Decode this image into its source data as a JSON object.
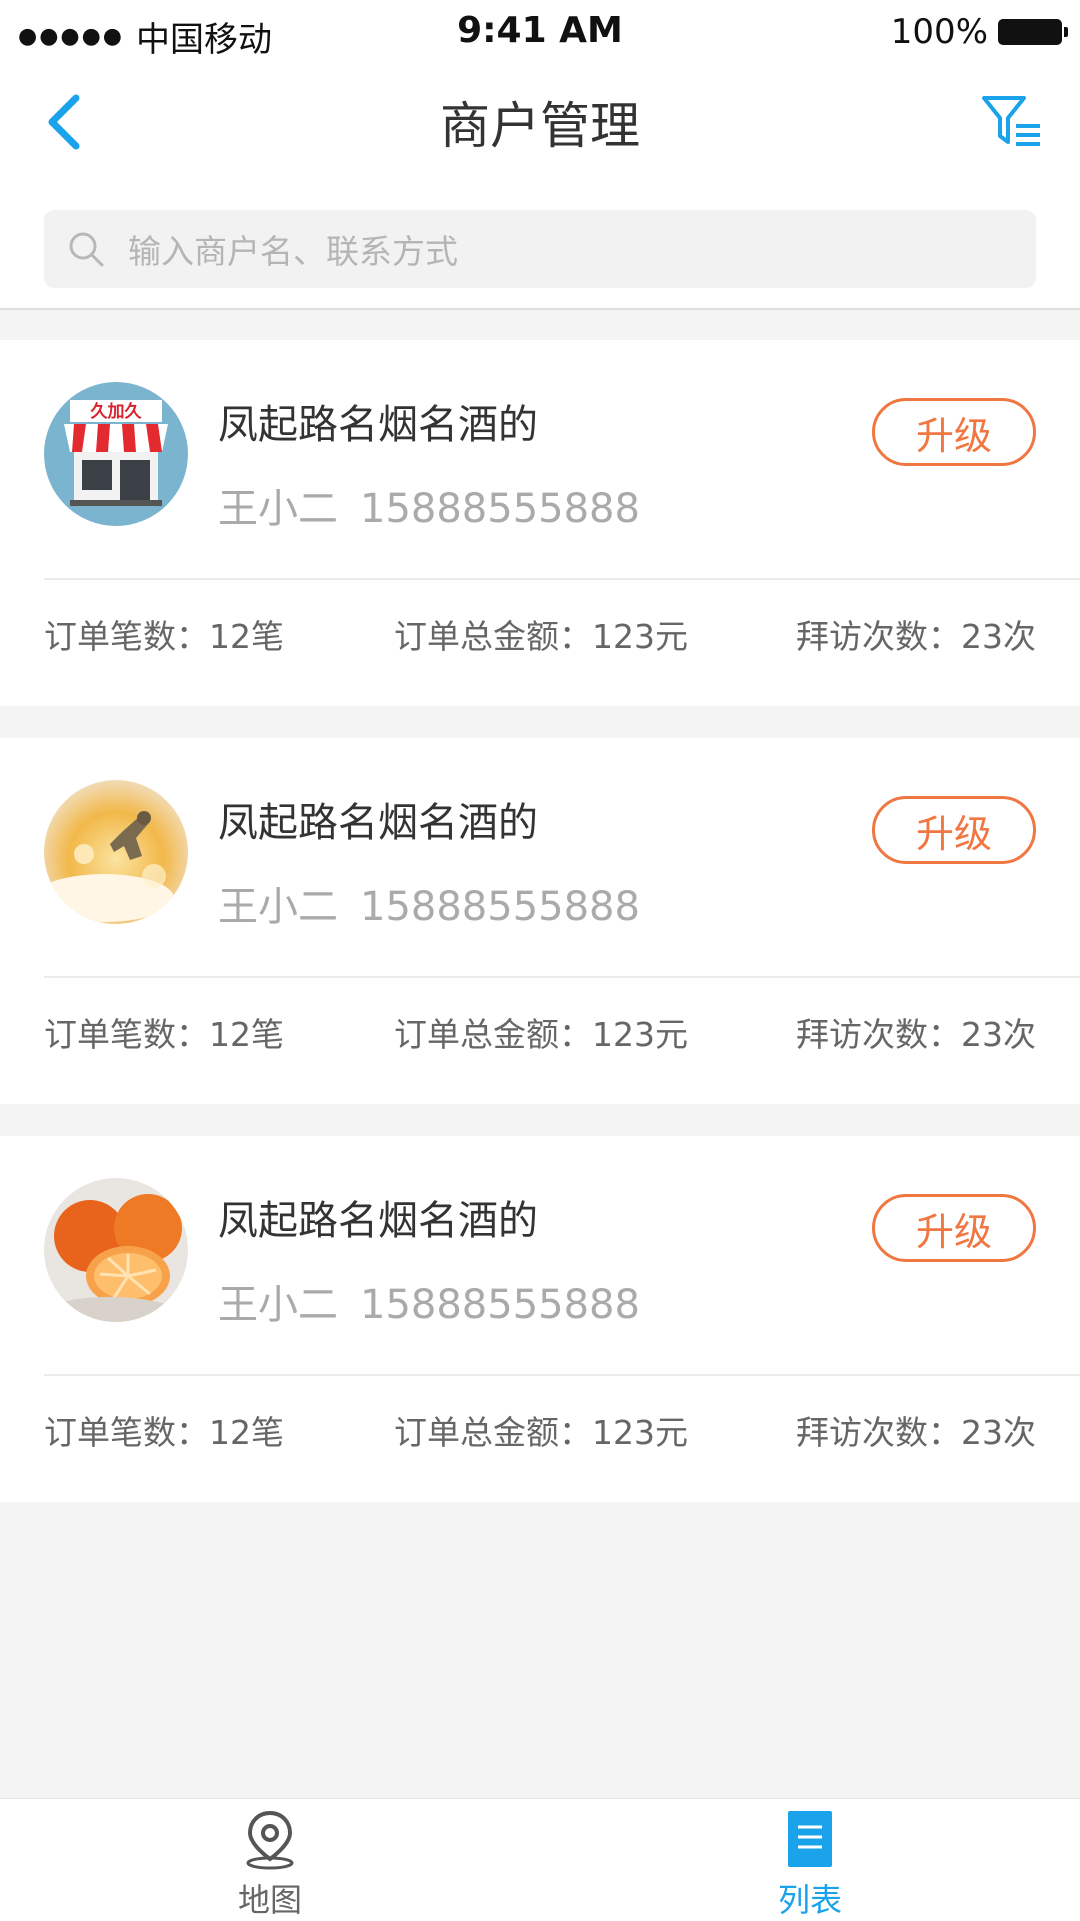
{
  "status_bar": {
    "signal": "●●●●●",
    "carrier": "中国移动",
    "time": "9:41 AM",
    "battery": "100%"
  },
  "nav": {
    "title": "商户管理",
    "back_icon": "chevron-left-icon",
    "filter_icon": "filter-icon"
  },
  "search": {
    "placeholder": "输入商户名、联系方式",
    "icon": "search-icon"
  },
  "merchants": [
    {
      "name": "凤起路名烟名酒的",
      "contact_name": "王小二",
      "phone": "15888555888",
      "action": "升级",
      "orders": "订单笔数：12笔",
      "amount": "订单总金额：123元",
      "visits": "拜访次数：23次",
      "avatar": "storefront"
    },
    {
      "name": "凤起路名烟名酒的",
      "contact_name": "王小二",
      "phone": "15888555888",
      "action": "升级",
      "orders": "订单笔数：12笔",
      "amount": "订单总金额：123元",
      "visits": "拜访次数：23次",
      "avatar": "splash"
    },
    {
      "name": "凤起路名烟名酒的",
      "contact_name": "王小二",
      "phone": "15888555888",
      "action": "升级",
      "orders": "订单笔数：12笔",
      "amount": "订单总金额：123元",
      "visits": "拜访次数：23次",
      "avatar": "oranges"
    }
  ],
  "store_sign": "久加久",
  "tabs": [
    {
      "label": "地图",
      "icon": "map-pin-icon",
      "active": false
    },
    {
      "label": "列表",
      "icon": "list-icon",
      "active": true
    }
  ],
  "colors": {
    "accent": "#1aa3ea",
    "upgrade": "#f07642",
    "background": "#f4f4f4"
  }
}
